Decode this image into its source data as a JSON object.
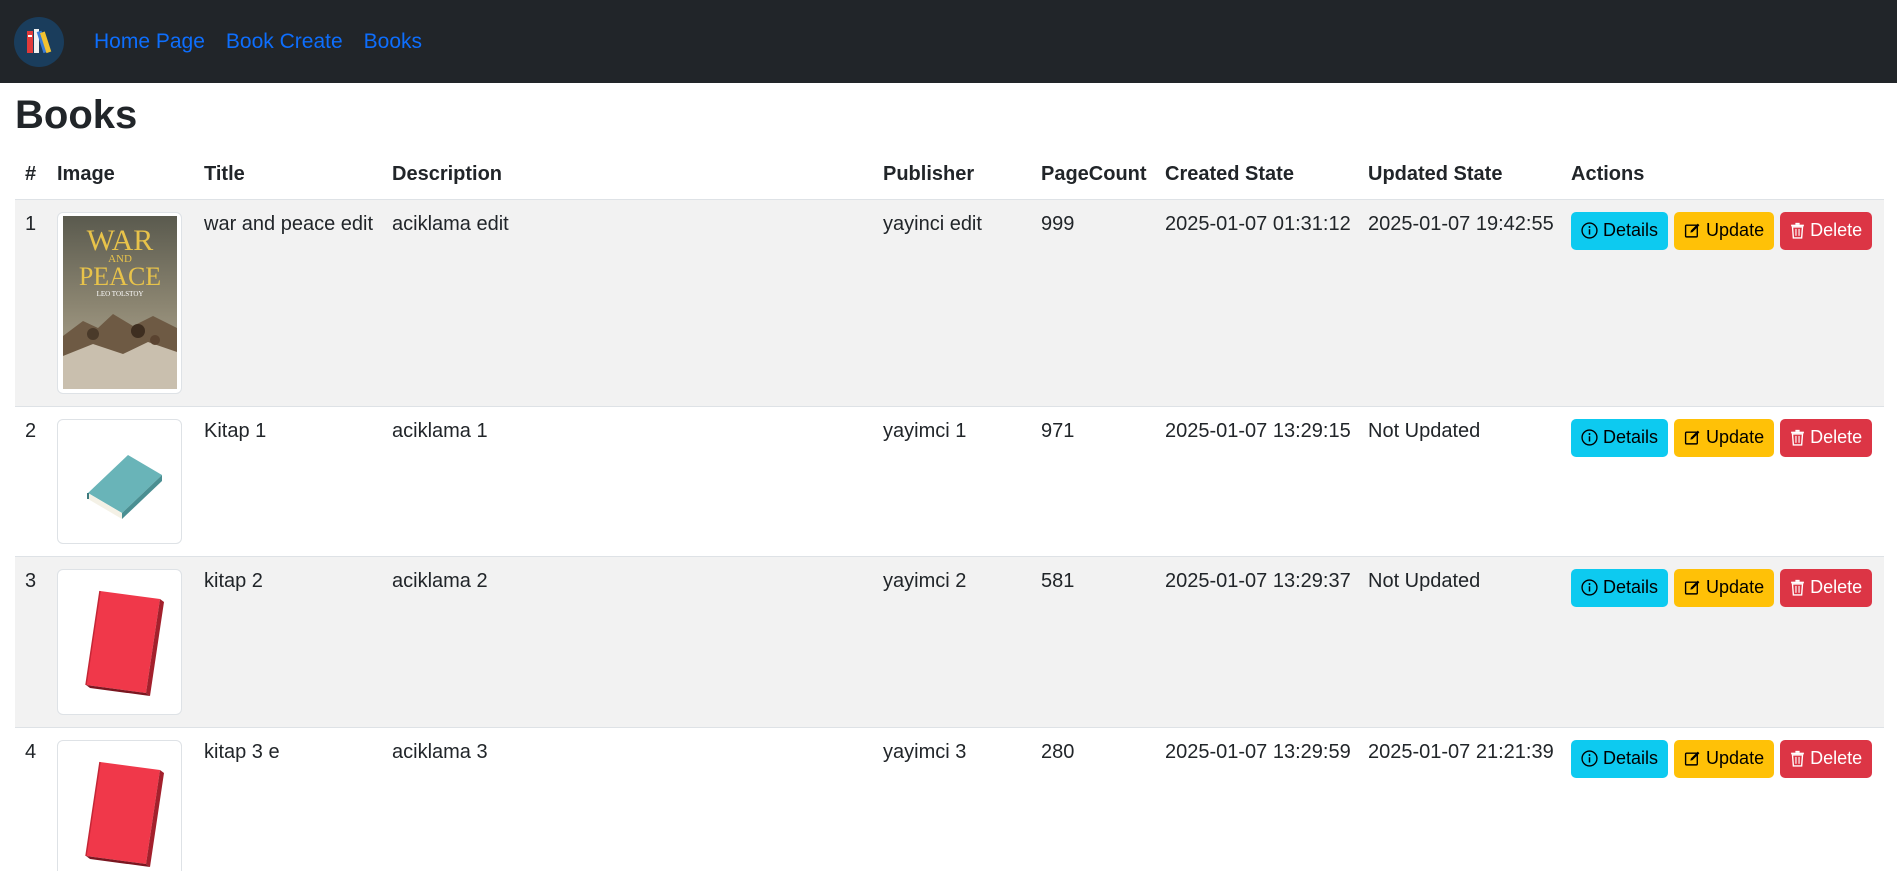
{
  "nav": {
    "links": [
      "Home Page",
      "Book Create",
      "Books"
    ]
  },
  "page": {
    "title": "Books"
  },
  "table": {
    "headers": [
      "#",
      "Image",
      "Title",
      "Description",
      "Publisher",
      "PageCount",
      "Created State",
      "Updated State",
      "Actions"
    ],
    "rows": [
      {
        "num": "1",
        "image": "war-and-peace-cover",
        "title": "war and peace edit",
        "description": "aciklama edit",
        "publisher": "yayinci edit",
        "page_count": "999",
        "created": "2025-01-07 01:31:12",
        "updated": "2025-01-07 19:42:55"
      },
      {
        "num": "2",
        "image": "teal-book",
        "title": "Kitap 1",
        "description": "aciklama 1",
        "publisher": "yayimci 1",
        "page_count": "971",
        "created": "2025-01-07 13:29:15",
        "updated": "Not Updated"
      },
      {
        "num": "3",
        "image": "red-book",
        "title": "kitap 2",
        "description": "aciklama 2",
        "publisher": "yayimci 2",
        "page_count": "581",
        "created": "2025-01-07 13:29:37",
        "updated": "Not Updated"
      },
      {
        "num": "4",
        "image": "red-book",
        "title": "kitap 3 e",
        "description": "aciklama 3",
        "publisher": "yayimci 3",
        "page_count": "280",
        "created": "2025-01-07 13:29:59",
        "updated": "2025-01-07 21:21:39"
      }
    ]
  },
  "cover": {
    "line1": "WAR",
    "line2": "AND",
    "line3": "PEACE",
    "author": "LEO TOLSTOY"
  },
  "actions": {
    "details": "Details",
    "update": "Update",
    "delete": "Delete"
  },
  "colors": {
    "navbar": "#212529",
    "link": "#0d6efd",
    "info": "#0dcaf0",
    "warning": "#ffc107",
    "danger": "#dc3545",
    "stripe": "#f2f2f2"
  }
}
